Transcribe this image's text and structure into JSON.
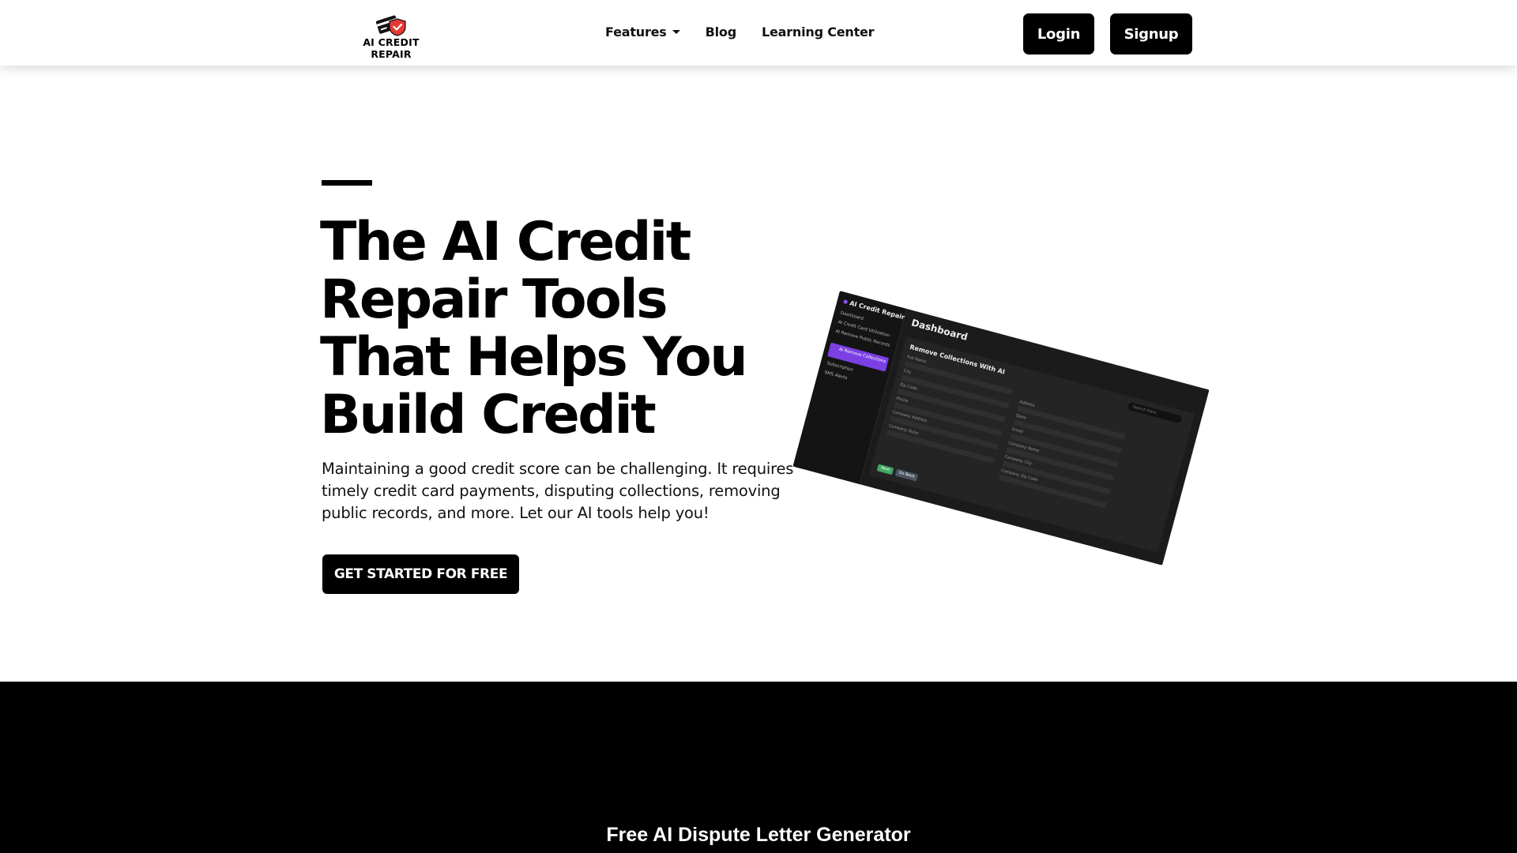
{
  "brand": {
    "name": "AI CREDIT REPAIR",
    "shield_color": "#e53935"
  },
  "nav": {
    "features": "Features",
    "blog": "Blog",
    "learning_center": "Learning Center"
  },
  "auth": {
    "login": "Login",
    "signup": "Signup"
  },
  "hero": {
    "title": "The AI Credit Repair Tools That Helps You Build Credit",
    "description": "Maintaining a good credit score can be challenging. It requires timely credit card payments, disputing collections, removing public records, and more. Let our AI tools help you!",
    "cta": "GET STARTED FOR FREE"
  },
  "mockup": {
    "brand": "AI Credit Repair",
    "menu": [
      "Dashboard",
      "AI Credit Card Utilization",
      "AI Remove Public Records",
      "SMS Alerts"
    ],
    "active_item": "AI Remove Collections",
    "subscription": "Subscription",
    "page_title": "Dashboard",
    "card_title": "Remove Collections With AI",
    "search_placeholder": "Search Here",
    "left_fields": [
      "Full Name",
      "City",
      "Zip Code",
      "Phone",
      "Company Address",
      "Company State"
    ],
    "right_fields": [
      "Address",
      "State",
      "Email",
      "Company Name",
      "Company City",
      "Company Zip Code"
    ],
    "next": "Next",
    "go_back": "Go Back",
    "accent_color": "#7b3fe4"
  },
  "section2": {
    "heading": "Free AI Dispute Letter Generator"
  }
}
